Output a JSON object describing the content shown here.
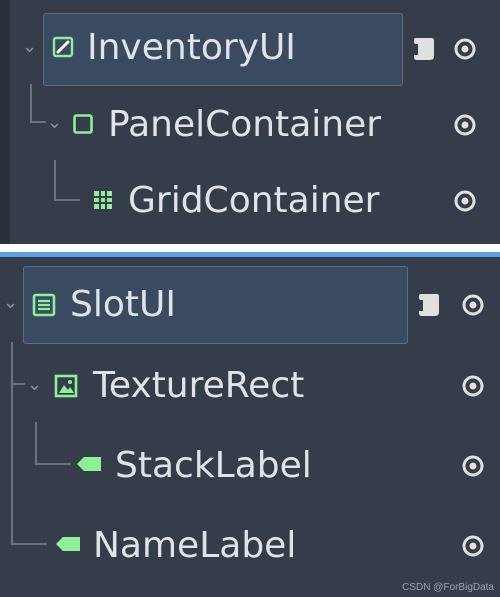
{
  "trees": [
    {
      "nodes": [
        {
          "label": "InventoryUI",
          "icon": "control-edit-icon",
          "selected": true,
          "has_script": true,
          "expanded": true
        },
        {
          "label": "PanelContainer",
          "icon": "panel-container-icon",
          "selected": false,
          "has_script": false,
          "expanded": true
        },
        {
          "label": "GridContainer",
          "icon": "grid-container-icon",
          "selected": false,
          "has_script": false,
          "expanded": false
        }
      ]
    },
    {
      "nodes": [
        {
          "label": "SlotUI",
          "icon": "list-container-icon",
          "selected": true,
          "has_script": true,
          "expanded": true
        },
        {
          "label": "TextureRect",
          "icon": "texture-rect-icon",
          "selected": false,
          "has_script": false,
          "expanded": true
        },
        {
          "label": "StackLabel",
          "icon": "label-tag-icon",
          "selected": false,
          "has_script": false,
          "expanded": false
        },
        {
          "label": "NameLabel",
          "icon": "label-tag-icon",
          "selected": false,
          "has_script": false,
          "expanded": false
        }
      ]
    }
  ],
  "colors": {
    "panel_bg": "#363d4a",
    "selected_bg": "#3a4a60",
    "node_green": "#8eef97",
    "text": "#e0e3e8",
    "accent": "#5aa0e6"
  },
  "watermark": "CSDN @ForBigData"
}
